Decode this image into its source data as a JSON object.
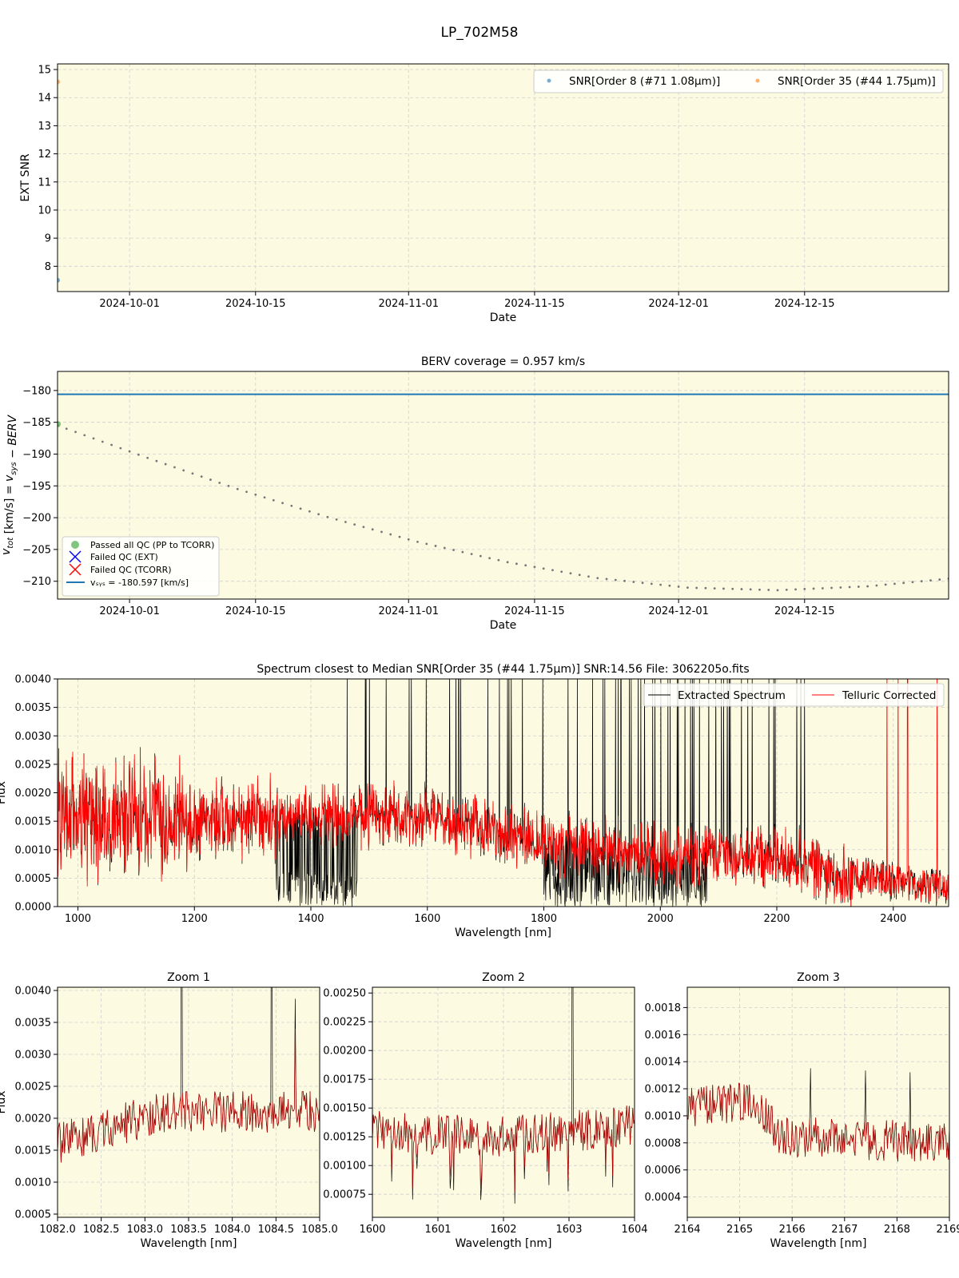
{
  "figure": {
    "title": "LP_702M58",
    "background": "#ffffff",
    "axes_facecolor": "#fcfbe2",
    "grid_color": "#cfcfcf"
  },
  "chart_data": [
    {
      "type": "scatter",
      "title": "",
      "xlabel": "Date",
      "ylabel": "EXT SNR",
      "x_range": [
        "2024-09-23",
        "2024-12-31"
      ],
      "ylim": [
        7.1,
        15.2
      ],
      "x_ticks": [
        "2024-10-01",
        "2024-10-15",
        "2024-11-01",
        "2024-11-15",
        "2024-12-01",
        "2024-12-15"
      ],
      "y_ticks": [
        8,
        9,
        10,
        11,
        12,
        13,
        14,
        15
      ],
      "grid": true,
      "legend_position": "top-right",
      "series": [
        {
          "name": "SNR[Order 8 (#71 1.08μm)]",
          "color": "#1f77b4",
          "points": [
            {
              "x": "2024-09-23",
              "y": 7.5
            }
          ]
        },
        {
          "name": "SNR[Order 35 (#44 1.75μm)]",
          "color": "#ff7f0e",
          "points": [
            {
              "x": "2024-09-23",
              "y": 14.56
            }
          ]
        }
      ]
    },
    {
      "type": "line",
      "title": "BERV coverage = 0.957 km/s",
      "xlabel": "Date",
      "ylabel": "v_tot [km/s] = v_sys − BERV",
      "x_range": [
        "2024-09-23",
        "2024-12-31"
      ],
      "ylim": [
        -212.8,
        -177.0
      ],
      "x_ticks": [
        "2024-10-01",
        "2024-10-15",
        "2024-11-01",
        "2024-11-15",
        "2024-12-01",
        "2024-12-15"
      ],
      "y_ticks": [
        -180,
        -185,
        -190,
        -195,
        -200,
        -205,
        -210
      ],
      "grid": true,
      "legend_position": "lower-left",
      "vsys": -180.597,
      "berv_curve": [
        {
          "x": "2024-09-23",
          "y": -185.5
        },
        {
          "x": "2024-10-03",
          "y": -190.6
        },
        {
          "x": "2024-10-13",
          "y": -195.5
        },
        {
          "x": "2024-10-23",
          "y": -199.9
        },
        {
          "x": "2024-11-02",
          "y": -203.8
        },
        {
          "x": "2024-11-12",
          "y": -207.0
        },
        {
          "x": "2024-11-22",
          "y": -209.5
        },
        {
          "x": "2024-12-02",
          "y": -211.0
        },
        {
          "x": "2024-12-12",
          "y": -211.4
        },
        {
          "x": "2024-12-22",
          "y": -210.8
        },
        {
          "x": "2024-12-31",
          "y": -209.6
        }
      ],
      "observations": [
        {
          "x": "2024-09-23",
          "y": -185.3
        }
      ],
      "legend": [
        {
          "label": "Passed all QC (PP to TCORR)",
          "marker": "circle",
          "color": "#2ca02c"
        },
        {
          "label": "Failed QC (EXT)",
          "marker": "x",
          "color": "#0000ff"
        },
        {
          "label": "Failed QC (TCORR)",
          "marker": "x",
          "color": "#ff0000"
        },
        {
          "label": "v_sys = -180.597 [km/s]",
          "marker": "line",
          "color": "#1f77b4"
        }
      ]
    },
    {
      "type": "line",
      "title": "Spectrum closest to Median SNR[Order 35 (#44 1.75μm)]     SNR:14.56     File: 3062205o.fits",
      "xlabel": "Wavelength [nm]",
      "ylabel": "Flux",
      "xlim": [
        965,
        2495
      ],
      "ylim": [
        0,
        0.004
      ],
      "x_ticks": [
        1000,
        1200,
        1400,
        1600,
        1800,
        2000,
        2200,
        2400
      ],
      "y_ticks": [
        0.0,
        0.0005,
        0.001,
        0.0015,
        0.002,
        0.0025,
        0.003,
        0.0035,
        0.004
      ],
      "y_tick_labels": [
        "0.0000",
        "0.0005",
        "0.0010",
        "0.0015",
        "0.0020",
        "0.0025",
        "0.0030",
        "0.0035",
        "0.0040"
      ],
      "grid": true,
      "legend_position": "top-right",
      "series": [
        {
          "name": "Extracted Spectrum",
          "color": "#000000"
        },
        {
          "name": "Telluric Corrected",
          "color": "#ff0000"
        }
      ],
      "continuum": [
        {
          "x": 965,
          "y": 0.0016
        },
        {
          "x": 1200,
          "y": 0.00155
        },
        {
          "x": 1400,
          "y": 0.0016
        },
        {
          "x": 1600,
          "y": 0.0016
        },
        {
          "x": 1800,
          "y": 0.0011
        },
        {
          "x": 2000,
          "y": 0.0009
        },
        {
          "x": 2200,
          "y": 0.0009
        },
        {
          "x": 2300,
          "y": 0.0006
        },
        {
          "x": 2495,
          "y": 0.0003
        }
      ]
    },
    {
      "type": "line",
      "title": "Zoom 1",
      "xlabel": "Wavelength [nm]",
      "ylabel": "Flux",
      "xlim": [
        1082.0,
        1085.0
      ],
      "ylim": [
        0.00045,
        0.00405
      ],
      "x_ticks": [
        1082.0,
        1082.5,
        1083.0,
        1083.5,
        1084.0,
        1084.5,
        1085.0
      ],
      "x_tick_labels": [
        "1082.0",
        "1082.5",
        "1083.0",
        "1083.5",
        "1084.0",
        "1084.5",
        "1085.0"
      ],
      "y_ticks": [
        0.0005,
        0.001,
        0.0015,
        0.002,
        0.0025,
        0.003,
        0.0035,
        0.004
      ],
      "y_tick_labels": [
        "0.0005",
        "0.0010",
        "0.0015",
        "0.0020",
        "0.0025",
        "0.0030",
        "0.0035",
        "0.0040"
      ],
      "grid": true,
      "continuum": [
        {
          "x": 1082.0,
          "y": 0.0016
        },
        {
          "x": 1083.2,
          "y": 0.0021
        },
        {
          "x": 1085.0,
          "y": 0.0021
        }
      ],
      "spikes": [
        1083.42,
        1084.45,
        1084.72
      ]
    },
    {
      "type": "line",
      "title": "Zoom 2",
      "xlabel": "Wavelength [nm]",
      "ylabel": "",
      "xlim": [
        1600,
        1604
      ],
      "ylim": [
        0.00055,
        0.00255
      ],
      "x_ticks": [
        1600,
        1601,
        1602,
        1603,
        1604
      ],
      "y_ticks": [
        0.00075,
        0.001,
        0.00125,
        0.0015,
        0.00175,
        0.002,
        0.00225,
        0.0025
      ],
      "y_tick_labels": [
        "0.00075",
        "0.00100",
        "0.00125",
        "0.00150",
        "0.00175",
        "0.00200",
        "0.00225",
        "0.00250"
      ],
      "grid": true,
      "continuum": [
        {
          "x": 1600,
          "y": 0.0013
        },
        {
          "x": 1602,
          "y": 0.00125
        },
        {
          "x": 1604,
          "y": 0.00135
        }
      ],
      "spikes": [
        1603.05
      ]
    },
    {
      "type": "line",
      "title": "Zoom 3",
      "xlabel": "Wavelength [nm]",
      "ylabel": "",
      "xlim": [
        2164,
        2169
      ],
      "ylim": [
        0.00025,
        0.00195
      ],
      "x_ticks": [
        2164,
        2165,
        2166,
        2167,
        2168,
        2169
      ],
      "y_ticks": [
        0.0004,
        0.0006,
        0.0008,
        0.001,
        0.0012,
        0.0014,
        0.0016,
        0.0018
      ],
      "y_tick_labels": [
        "0.0004",
        "0.0006",
        "0.0008",
        "0.0010",
        "0.0012",
        "0.0014",
        "0.0016",
        "0.0018"
      ],
      "grid": true,
      "continuum": [
        {
          "x": 2164,
          "y": 0.00105
        },
        {
          "x": 2165.2,
          "y": 0.00112
        },
        {
          "x": 2165.8,
          "y": 0.00085
        },
        {
          "x": 2169,
          "y": 0.0008
        }
      ],
      "spikes": [
        2166.35,
        2167.4,
        2168.25
      ]
    }
  ]
}
